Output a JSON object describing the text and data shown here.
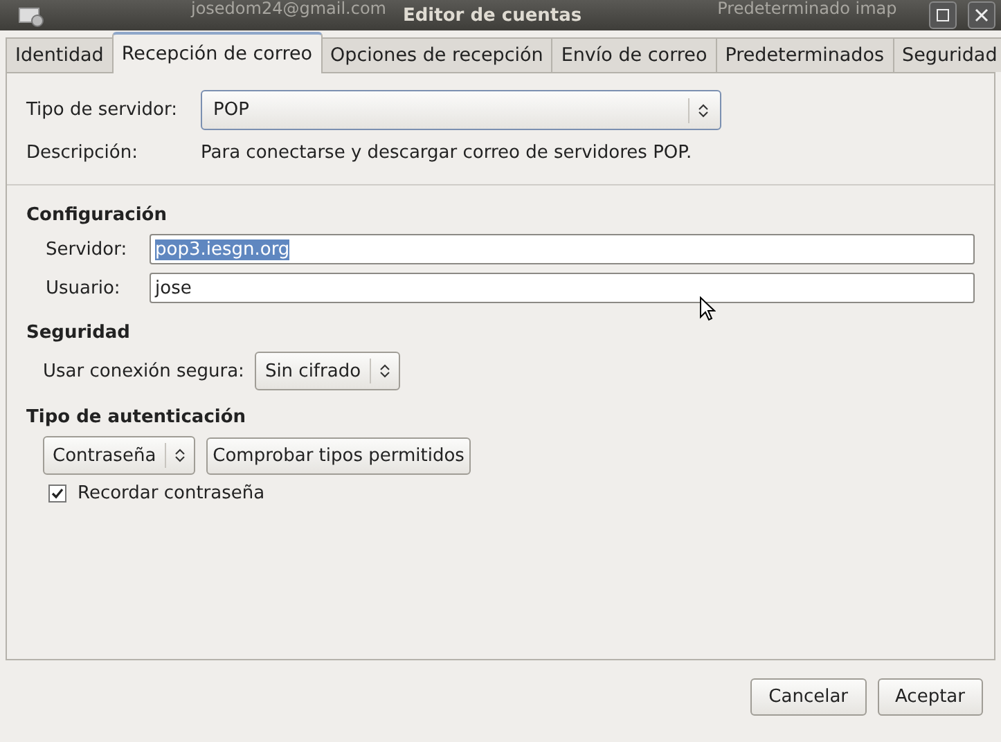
{
  "window": {
    "title": "Editor de cuentas",
    "background_texts": [
      "josedom24@gmail.com",
      "Predeterminado  imap"
    ]
  },
  "tabs": [
    {
      "label": "Identidad",
      "selected": false
    },
    {
      "label": "Recepción de correo",
      "selected": true
    },
    {
      "label": "Opciones de recepción",
      "selected": false
    },
    {
      "label": "Envío de correo",
      "selected": false
    },
    {
      "label": "Predeterminados",
      "selected": false
    },
    {
      "label": "Seguridad",
      "selected": false
    }
  ],
  "server_type": {
    "label": "Tipo de servidor:",
    "value": "POP"
  },
  "description": {
    "label": "Descripción:",
    "text": "Para conectarse y descargar correo de servidores POP."
  },
  "configuration": {
    "heading": "Configuración",
    "fields": [
      {
        "label": "Servidor:",
        "value": "pop3.iesgn.org",
        "selected": true
      },
      {
        "label": "Usuario:",
        "value": "jose",
        "selected": false
      }
    ]
  },
  "security": {
    "heading": "Seguridad",
    "label": "Usar conexión segura:",
    "value": "Sin cifrado"
  },
  "authentication": {
    "heading": "Tipo de autenticación",
    "value": "Contraseña",
    "check_button": "Comprobar tipos permitidos",
    "remember": {
      "label": "Recordar contraseña",
      "checked": true
    }
  },
  "buttons": [
    "Cancelar",
    "Aceptar"
  ]
}
